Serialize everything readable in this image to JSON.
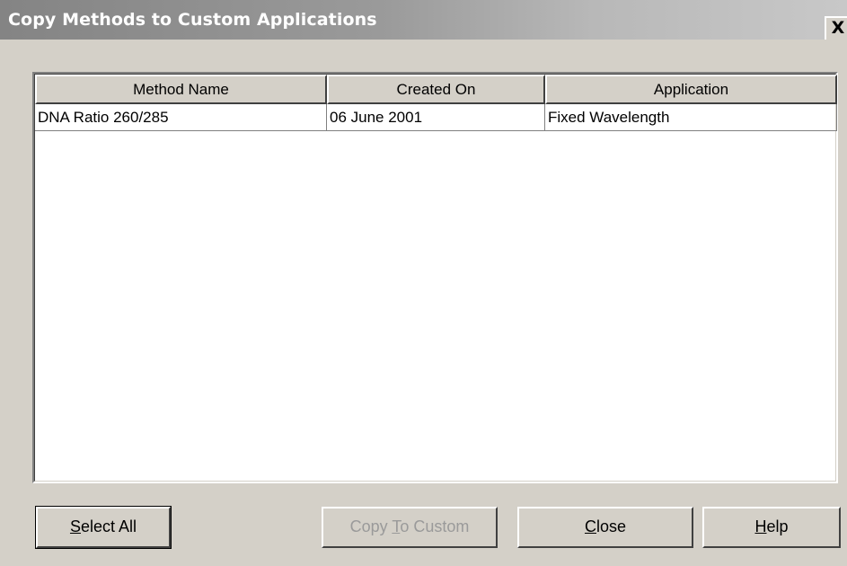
{
  "window": {
    "title": "Copy Methods to Custom Applications",
    "close_glyph": "X"
  },
  "table": {
    "columns": [
      "Method Name",
      "Created On",
      "Application"
    ],
    "rows": [
      {
        "method_name": "DNA Ratio 260/285",
        "created_on": "06 June 2001",
        "application": "Fixed Wavelength"
      }
    ]
  },
  "buttons": {
    "select_all": {
      "pre": "",
      "mnemonic": "S",
      "post": "elect All"
    },
    "copy_to_custom": {
      "pre": "Copy ",
      "mnemonic": "T",
      "post": "o Custom",
      "state": "disabled"
    },
    "close": {
      "pre": "",
      "mnemonic": "C",
      "post": "lose"
    },
    "help": {
      "pre": "",
      "mnemonic": "H",
      "post": "elp"
    }
  },
  "colors": {
    "face": "#d4d0c8",
    "titlebar_start": "#848484",
    "titlebar_end": "#c8c8c8",
    "disabled_text": "#9a9a9a"
  }
}
